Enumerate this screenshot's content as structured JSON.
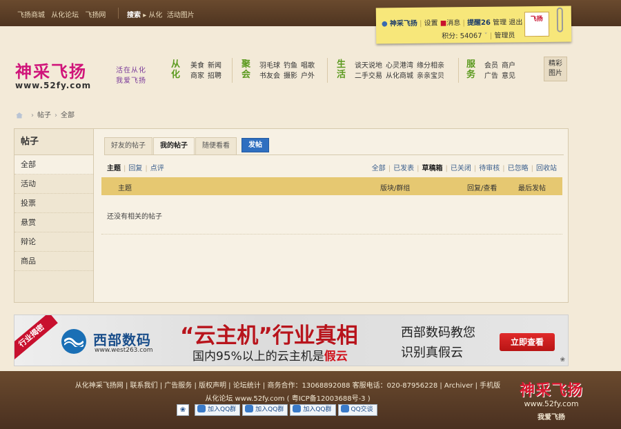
{
  "topbar": {
    "links": [
      "飞扬商城",
      "从化论坛",
      "飞扬网"
    ],
    "search_label": "搜索",
    "search_links": [
      "从化",
      "活动图片"
    ]
  },
  "user": {
    "name": "神采飞扬",
    "settings": "设置",
    "messages": "消息",
    "reminder": "提醒26",
    "manage": "管理",
    "logout": "退出",
    "points": "积分: 54067",
    "admin": "管理员",
    "avatar_text": "飞扬"
  },
  "logo": {
    "cn": "神采飞扬",
    "url": "www.52fy.com",
    "slogan1": "活在从化",
    "slogan2": "我爱飞扬"
  },
  "nav": [
    {
      "title": "从化",
      "color": "#5b9a1f",
      "rows": [
        [
          "美食",
          "新闻"
        ],
        [
          "商家",
          "招聘"
        ]
      ]
    },
    {
      "title": "聚会",
      "color": "#5b9a1f",
      "rows": [
        [
          "羽毛球",
          "钓鱼",
          "唱歌"
        ],
        [
          "书友会",
          "摄影",
          "户外"
        ]
      ]
    },
    {
      "title": "生活",
      "color": "#5b9a1f",
      "rows": [
        [
          "谈天说地",
          "心灵港湾",
          "缘分相亲"
        ],
        [
          "二手交易",
          "从化商城",
          "亲亲宝贝"
        ]
      ]
    },
    {
      "title": "服务",
      "color": "#5b9a1f",
      "rows": [
        [
          "会员",
          "商户"
        ],
        [
          "广告",
          "意见"
        ]
      ]
    }
  ],
  "jingcai": {
    "line1": "精彩",
    "line2": "图片"
  },
  "breadcrumb": [
    "帖子",
    "全部"
  ],
  "sidebar": {
    "title": "帖子",
    "items": [
      "全部",
      "活动",
      "投票",
      "悬赏",
      "辩论",
      "商品"
    ]
  },
  "tabs": [
    "好友的帖子",
    "我的帖子",
    "随便看看"
  ],
  "post_button": "发帖",
  "subfilter": [
    "主题",
    "回复",
    "点评"
  ],
  "rightfilter": [
    "全部",
    "已发表",
    "草稿箱",
    "已关闭",
    "待审核",
    "已忽略",
    "回收站"
  ],
  "table": {
    "headers": [
      "主题",
      "版块/群组",
      "回复/查看",
      "最后发帖"
    ],
    "empty": "还没有相关的帖子"
  },
  "ad": {
    "ribbon": "行业揭密",
    "brand": "西部数码",
    "brand_url": "www.west263.com",
    "headline": "“云主机”行业真相",
    "sub_pre": "国内95%以上的云主机是",
    "sub_hl": "假云",
    "right1": "西部数码教您",
    "right2": "识别真假云",
    "cta": "立即查看"
  },
  "footer": {
    "line1": "从化神采飞扬网 | 联系我们 | 广告服务 | 版权声明 | 论坛统计 | 商务合作：13068892088 客服电话：020-87956228 | Archiver | 手机版",
    "line2": "从化论坛 www.52fy.com ( 粤ICP备12003688号-3 )",
    "qq_buttons": [
      "加入QQ群",
      "加入QQ群",
      "加入QQ群",
      "QQ交谈"
    ],
    "logo_cn": "神采飞扬",
    "logo_url": "www.52fy.com",
    "logo_slogan": "我爱飞扬"
  }
}
